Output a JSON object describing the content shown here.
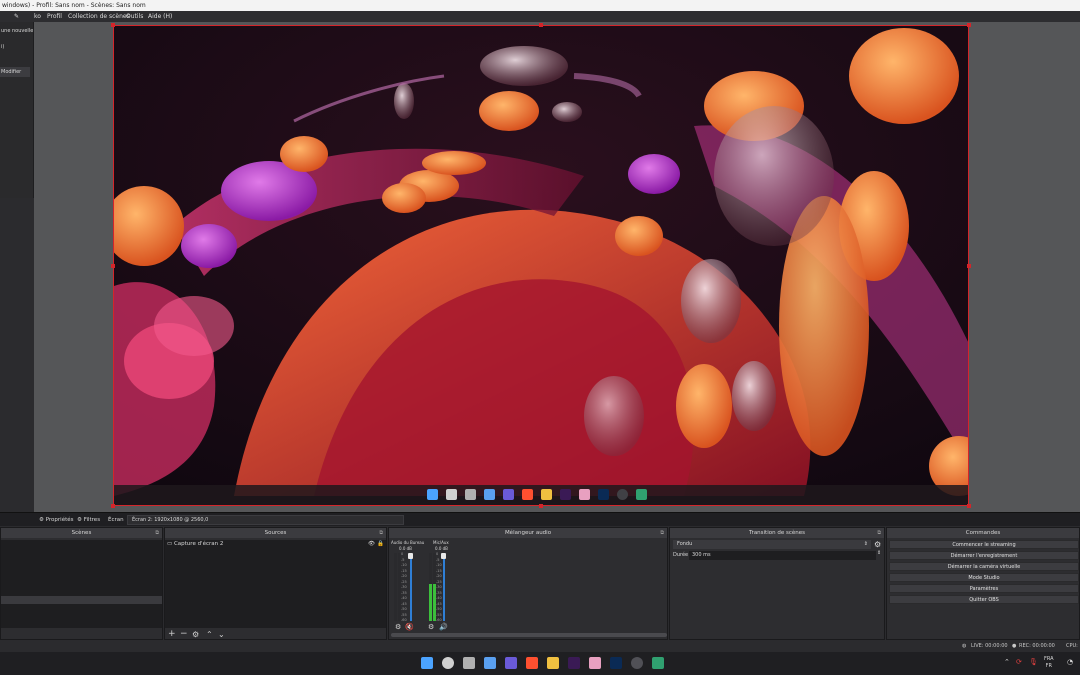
{
  "window": {
    "title": "windows) - Profil: Sans nom - Scènes: Sans nom"
  },
  "menu": {
    "items": [
      "ko",
      "Profil",
      "Collection de scènes",
      "Outils",
      "Aide (H)"
    ]
  },
  "left_dock": {
    "item1": "une nouvelle d",
    "item2": "i)",
    "modify": "Modifier"
  },
  "properties_bar": {
    "properties_label": "Propriétés",
    "filters_label": "Filtres",
    "screen_label": "Écran",
    "screen_value": "Écran 2: 1920x1080 @ 2560,0"
  },
  "docks": {
    "scenes": {
      "title": "Scènes"
    },
    "sources": {
      "title": "Sources",
      "items": [
        "Capture d'écran 2"
      ]
    },
    "mixer": {
      "title": "Mélangeur audio",
      "channels": [
        {
          "name": "Audio du Bureau",
          "db": "0.0 dB",
          "level": 0.0,
          "muted": true
        },
        {
          "name": "Mic/Aux",
          "db": "0.0 dB",
          "level": 0.55,
          "muted": false
        }
      ],
      "scale": [
        "0",
        "-5",
        "-10",
        "-15",
        "-20",
        "-25",
        "-30",
        "-35",
        "-40",
        "-45",
        "-50",
        "-55",
        "-60"
      ]
    },
    "transitions": {
      "title": "Transition de scènes",
      "type": "Fondu",
      "duration_label": "Durée",
      "duration_value": "300 ms"
    },
    "controls": {
      "title": "Commandes",
      "buttons": [
        "Commencer le streaming",
        "Démarrer l'enregistrement",
        "Démarrer la caméra virtuelle",
        "Mode Studio",
        "Paramètres",
        "Quitter OBS"
      ]
    }
  },
  "status": {
    "live": "LIVE: 00:00:00",
    "rec": "REC: 00:00:00",
    "cpu": "CPU:"
  },
  "system_tray": {
    "lang_top": "FRA",
    "lang_bottom": "FR"
  },
  "colors": {
    "selection_red": "#d4252a",
    "panel_bg": "#2d2d30",
    "accent_blue": "#2f7fd6"
  }
}
